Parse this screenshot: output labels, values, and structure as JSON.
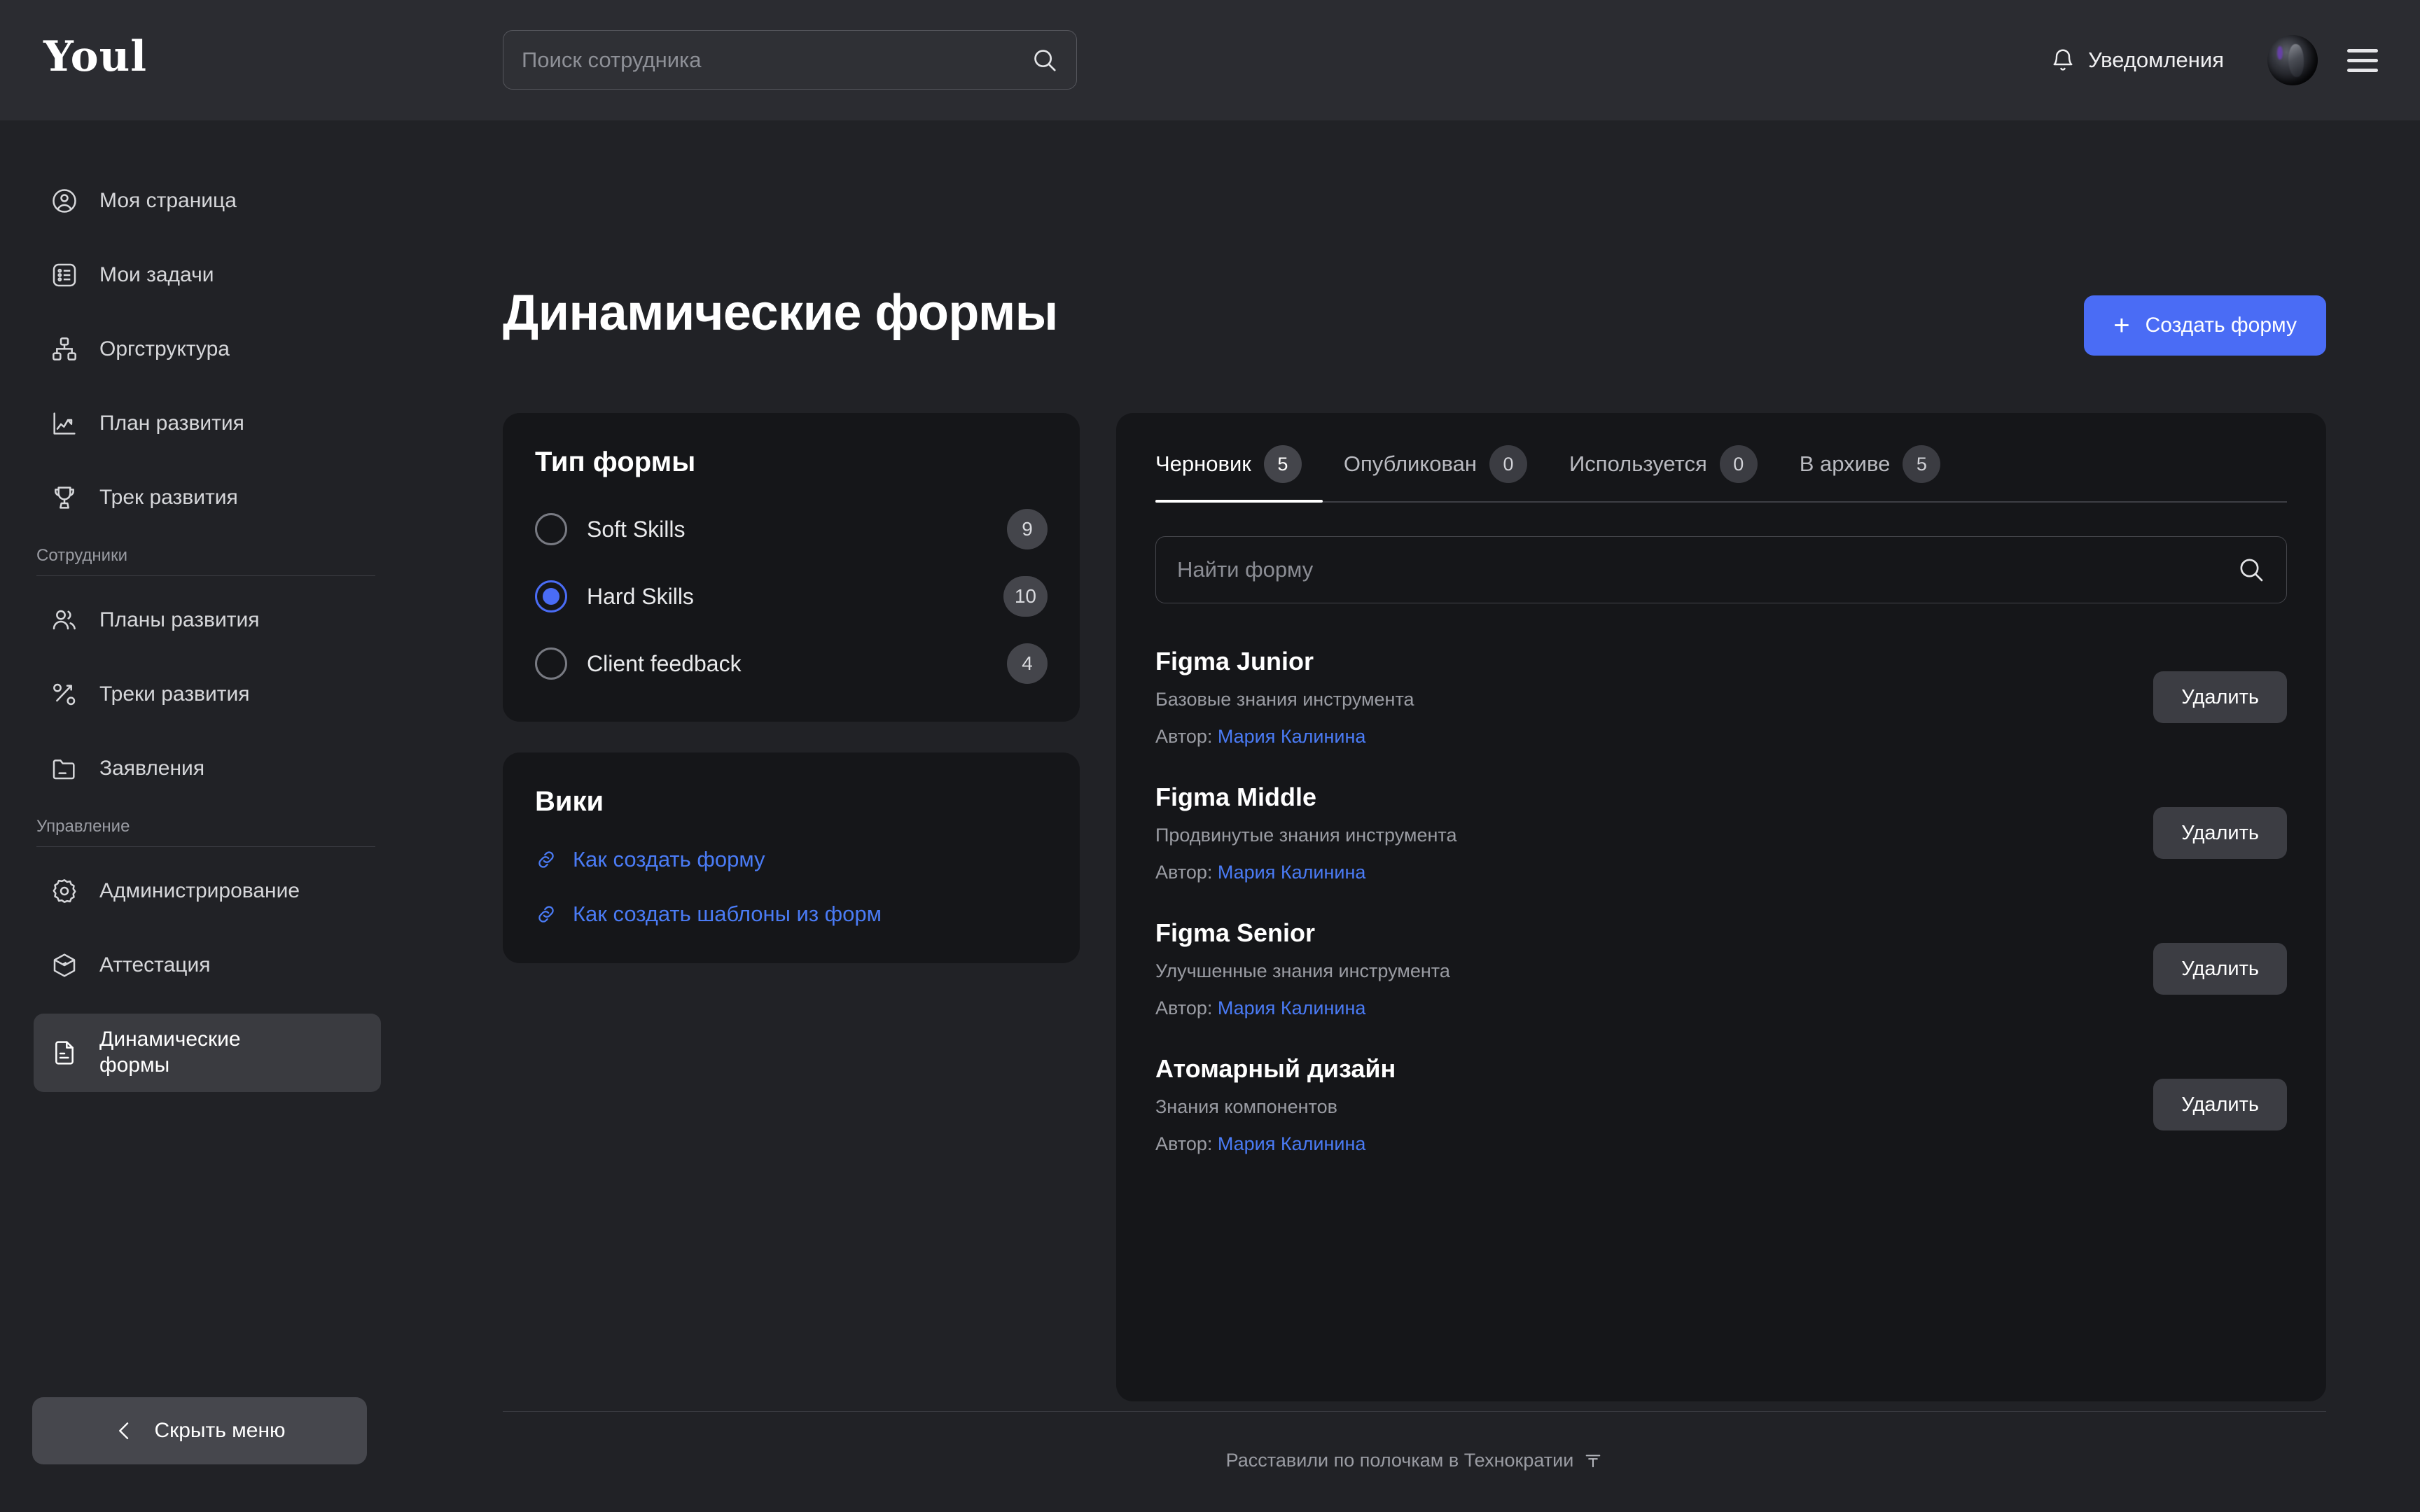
{
  "header": {
    "logo": "Youl",
    "search": {
      "value": "",
      "placeholder": "Поиск сотрудника"
    },
    "notifications_label": "Уведомления"
  },
  "sidebar": {
    "items": [
      {
        "label": "Моя страница",
        "icon": "user-circle-icon",
        "active": false
      },
      {
        "label": "Мои задачи",
        "icon": "list-box-icon",
        "active": false
      },
      {
        "label": "Оргструктура",
        "icon": "org-tree-icon",
        "active": false
      },
      {
        "label": "План развития",
        "icon": "chart-line-icon",
        "active": false
      },
      {
        "label": "Трек развития",
        "icon": "trophy-icon",
        "active": false
      }
    ],
    "group_employees": {
      "title": "Сотрудники",
      "items": [
        {
          "label": "Планы развития",
          "icon": "users-icon",
          "active": false
        },
        {
          "label": "Треки развития",
          "icon": "nodes-icon",
          "active": false
        },
        {
          "label": "Заявления",
          "icon": "folder-icon",
          "active": false
        }
      ]
    },
    "group_management": {
      "title": "Управление",
      "items": [
        {
          "label": "Администрирование",
          "icon": "gear-icon",
          "active": false
        },
        {
          "label": "Аттестация",
          "icon": "cube-icon",
          "active": false
        },
        {
          "label": "Динамические\nформы",
          "icon": "document-icon",
          "active": true
        }
      ]
    },
    "hide_menu_label": "Скрыть меню"
  },
  "main": {
    "title": "Динамические формы",
    "create_button": "Создать форму",
    "form_type_card": {
      "title": "Тип формы",
      "options": [
        {
          "label": "Soft Skills",
          "count": "9",
          "selected": false
        },
        {
          "label": "Hard Skills",
          "count": "10",
          "selected": true
        },
        {
          "label": "Client feedback",
          "count": "4",
          "selected": false
        }
      ]
    },
    "wiki_card": {
      "title": "Вики",
      "links": [
        {
          "label": "Как создать форму",
          "icon": "link-icon"
        },
        {
          "label": "Как создать шаблоны из форм",
          "icon": "link-icon"
        }
      ]
    },
    "panel": {
      "tabs": [
        {
          "label": "Черновик",
          "count": "5",
          "active": true
        },
        {
          "label": "Опубликован",
          "count": "0",
          "active": false
        },
        {
          "label": "Используется",
          "count": "0",
          "active": false
        },
        {
          "label": "В  архиве",
          "count": "5",
          "active": false
        }
      ],
      "search": {
        "value": "",
        "placeholder": "Найти форму"
      },
      "author_prefix": "Автор: ",
      "delete_label": "Удалить",
      "forms": [
        {
          "name": "Figma Junior",
          "description": "Базовые знания инструмента",
          "author": "Мария Калинина"
        },
        {
          "name": "Figma Middle",
          "description": "Продвинутые знания инструмента",
          "author": "Мария Калинина"
        },
        {
          "name": "Figma Senior",
          "description": "Улучшенные знания инструмента",
          "author": "Мария Калинина"
        },
        {
          "name": "Атомарный дизайн",
          "description": "Знания компонентов",
          "author": "Мария Калинина"
        }
      ]
    },
    "footer_text": "Расставили по полочкам в Технократии",
    "footer_logo": "⊤"
  },
  "colors": {
    "accent": "#4a6cf5",
    "link": "#4a7bf5",
    "page_bg": "#212226",
    "header_bg": "#2b2c31",
    "card_bg": "#151619"
  }
}
